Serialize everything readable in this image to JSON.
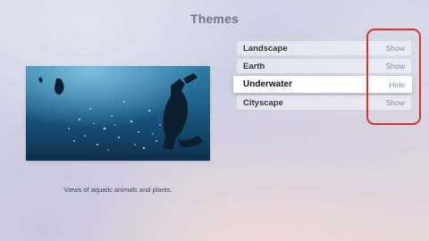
{
  "page": {
    "title": "Themes"
  },
  "preview": {
    "image": "underwater-scene",
    "caption": "Views of aquatic animals and plants."
  },
  "themes": [
    {
      "name": "Landscape",
      "action": "Show",
      "focused": false
    },
    {
      "name": "Earth",
      "action": "Show",
      "focused": false
    },
    {
      "name": "Underwater",
      "action": "Hide",
      "focused": true
    },
    {
      "name": "Cityscape",
      "action": "Show",
      "focused": false
    }
  ],
  "annotation": {
    "highlight_color": "#d7352c"
  }
}
